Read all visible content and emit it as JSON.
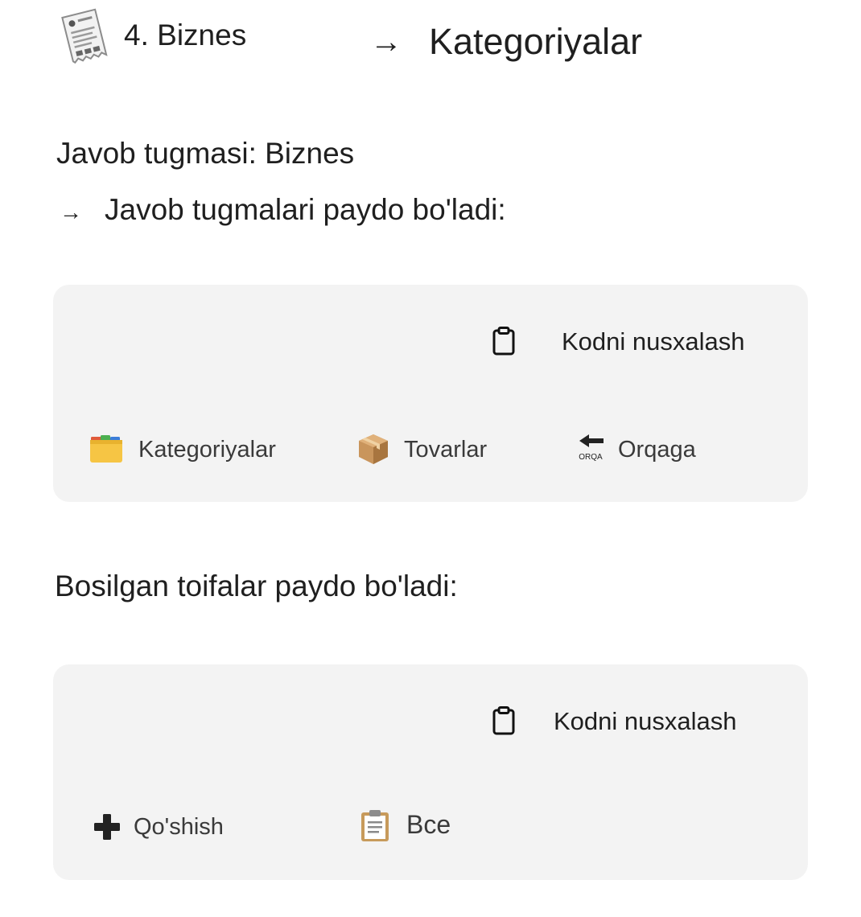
{
  "header": {
    "left_title": "4. Biznes",
    "arrow": "→",
    "right_title": "Kategoriyalar"
  },
  "intro": {
    "reply_button_line": "Javob tugmasi: Biznes",
    "arrow": "→",
    "reply_buttons_appear": "Javob tugmalari paydo bo'ladi:"
  },
  "panel1": {
    "copy_label": "Kodni nusxalash",
    "buttons": [
      {
        "icon": "folder-icon",
        "label": "Kategoriyalar"
      },
      {
        "icon": "package-icon",
        "label": "Tovarlar"
      },
      {
        "icon": "back-arrow-icon",
        "icon_caption": "ORQA",
        "label": "Orqaga"
      }
    ]
  },
  "categories_line": "Bosilgan toifalar paydo bo'ladi:",
  "panel2": {
    "copy_label": "Kodni nusxalash",
    "buttons": [
      {
        "icon": "plus-icon",
        "label": "Qo'shish"
      },
      {
        "icon": "clipboard-list-icon",
        "label": "Все"
      }
    ]
  },
  "colors": {
    "panel_bg": "#f3f3f3",
    "text": "#1f1f1f",
    "button_text": "#3a3a3a",
    "folder_yellow": "#f6c544",
    "box_brown": "#b9864f"
  }
}
